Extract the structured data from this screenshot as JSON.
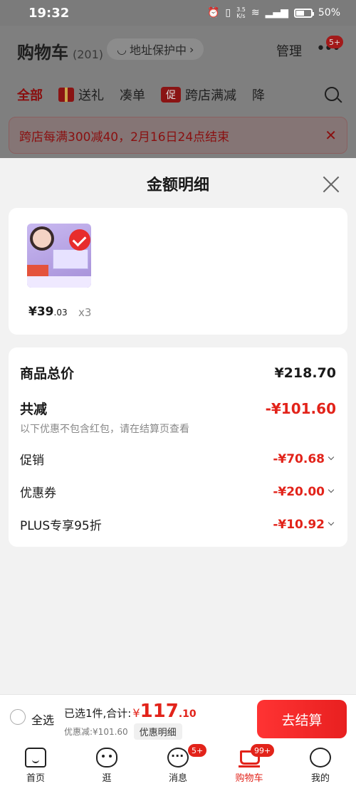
{
  "status_bar": {
    "time": "19:32",
    "net_speed_top": "3.5",
    "net_speed_bottom": "K/s",
    "signal": "5G",
    "battery": "50%",
    "battery_level": 0.5
  },
  "header": {
    "title": "购物车",
    "count": "(201)",
    "address_protect": "地址保护中",
    "manage": "管理",
    "more_badge": "5+"
  },
  "tabs": [
    "全部",
    "送礼",
    "凑单",
    "跨店满减",
    "降"
  ],
  "tab_promo_icon": "促",
  "notice": {
    "text": "跨店每满300减40，2月16日24点结束"
  },
  "sheet": {
    "title": "金额明细",
    "product": {
      "price_int": "¥39",
      "price_dec": ".03",
      "quantity": "x3"
    },
    "total": {
      "label": "商品总价",
      "value": "¥218.70"
    },
    "savings": {
      "label": "共减",
      "value": "-¥101.60",
      "note": "以下优惠不包含红包，请在结算页查看"
    },
    "items": [
      {
        "label": "促销",
        "value": "-¥70.68"
      },
      {
        "label": "优惠券",
        "value": "-¥20.00"
      },
      {
        "label": "PLUS专享95折",
        "value": "-¥10.92"
      }
    ]
  },
  "checkout": {
    "select_all": "全选",
    "selected_text": "已选1件,合计:",
    "currency": "¥",
    "total_int": "117",
    "total_dec": ".10",
    "discount_text": "优惠减:¥101.60",
    "detail_button": "优惠明细",
    "pay_button": "去结算"
  },
  "tabbar": [
    {
      "label": "首页",
      "icon": "home-icon"
    },
    {
      "label": "逛",
      "icon": "face-icon"
    },
    {
      "label": "消息",
      "icon": "message-icon",
      "badge": "5+"
    },
    {
      "label": "购物车",
      "icon": "cart-icon",
      "badge": "99+"
    },
    {
      "label": "我的",
      "icon": "profile-icon"
    }
  ]
}
